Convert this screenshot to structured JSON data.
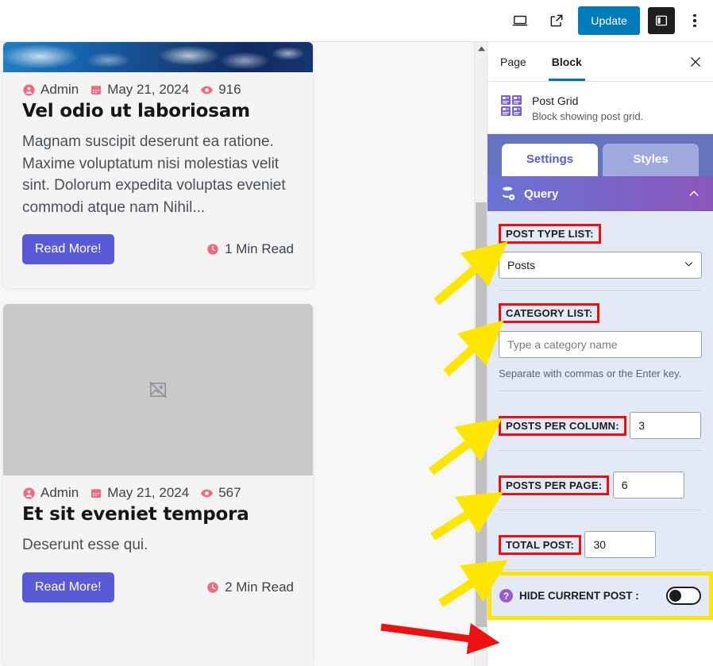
{
  "topbar": {
    "device_icon": "desktop-preview-icon",
    "external_icon": "view-external-link-icon",
    "update_label": "Update",
    "sidebar_toggle_icon": "settings-sidebar-icon",
    "options_icon": "kebab-menu-icon"
  },
  "editor": {
    "posts": [
      {
        "author": "Admin",
        "date": "May 21, 2024",
        "views": "916",
        "title": "Vel odio ut laboriosam",
        "excerpt": "Magnam suscipit deserunt ea ratione. Maxime voluptatum nisi molestias velit sint. Dolorum expedita voluptas eveniet commodi atque nam Nihil...",
        "read_more": "Read More!",
        "read_time": "1 Min Read",
        "image_kind": "ocean-photo"
      },
      {
        "author": "Admin",
        "date": "May 21, 2024",
        "views": "567",
        "title": "Et sit eveniet tempora",
        "excerpt": "Deserunt esse qui.",
        "read_more": "Read More!",
        "read_time": "2 Min Read",
        "image_kind": "broken-image-placeholder"
      }
    ]
  },
  "sidebar": {
    "tabs": [
      {
        "label": "Page",
        "active": false
      },
      {
        "label": "Block",
        "active": true
      }
    ],
    "close_icon": "close-icon",
    "block": {
      "name": "Post Grid",
      "description": "Block showing post grid.",
      "icon": "post-grid-icon"
    },
    "segmented": {
      "settings_label": "Settings",
      "styles_label": "Styles",
      "selected": "Settings"
    },
    "panel": {
      "title": "Query",
      "icon": "database-query-icon",
      "collapse_icon": "chevron-up-icon",
      "fields": [
        {
          "key": "post_type_list",
          "label": "POST TYPE LIST:",
          "control": "select",
          "value": "Posts",
          "highlight": "red-box"
        },
        {
          "key": "category_list",
          "label": "CATEGORY LIST:",
          "control": "text",
          "value": "",
          "placeholder": "Type a category name",
          "help": "Separate with commas or the Enter key.",
          "highlight": "red-box"
        },
        {
          "key": "posts_per_column",
          "label": "POSTS PER COLUMN:",
          "control": "number",
          "value": "3",
          "highlight": "red-box"
        },
        {
          "key": "posts_per_page",
          "label": "POSTS PER PAGE:",
          "control": "number",
          "value": "6",
          "highlight": "red-box"
        },
        {
          "key": "total_post",
          "label": "TOTAL POST:",
          "control": "number",
          "value": "30",
          "highlight": "red-box"
        }
      ],
      "hide_current_post": {
        "label": "HIDE CURRENT POST :",
        "help_icon": "question-mark-icon",
        "toggle_state": "off",
        "highlight": "yellow-box"
      }
    }
  },
  "annotations": {
    "yellow_arrow_count": 5,
    "red_arrow_count": 1,
    "colors": {
      "red_box": "#e81010",
      "yellow_box": "#ffe600",
      "yellow_arrow": "#ffe600",
      "red_arrow": "#ee1111",
      "accent_blue": "#007cba",
      "brand_purple": "#5a5fc7",
      "meta_pink": "#f4687f",
      "read_more_purple": "#5a5ad6"
    }
  },
  "scrollbar": {
    "up_arrow_icon": "scroll-up-arrow-icon"
  }
}
